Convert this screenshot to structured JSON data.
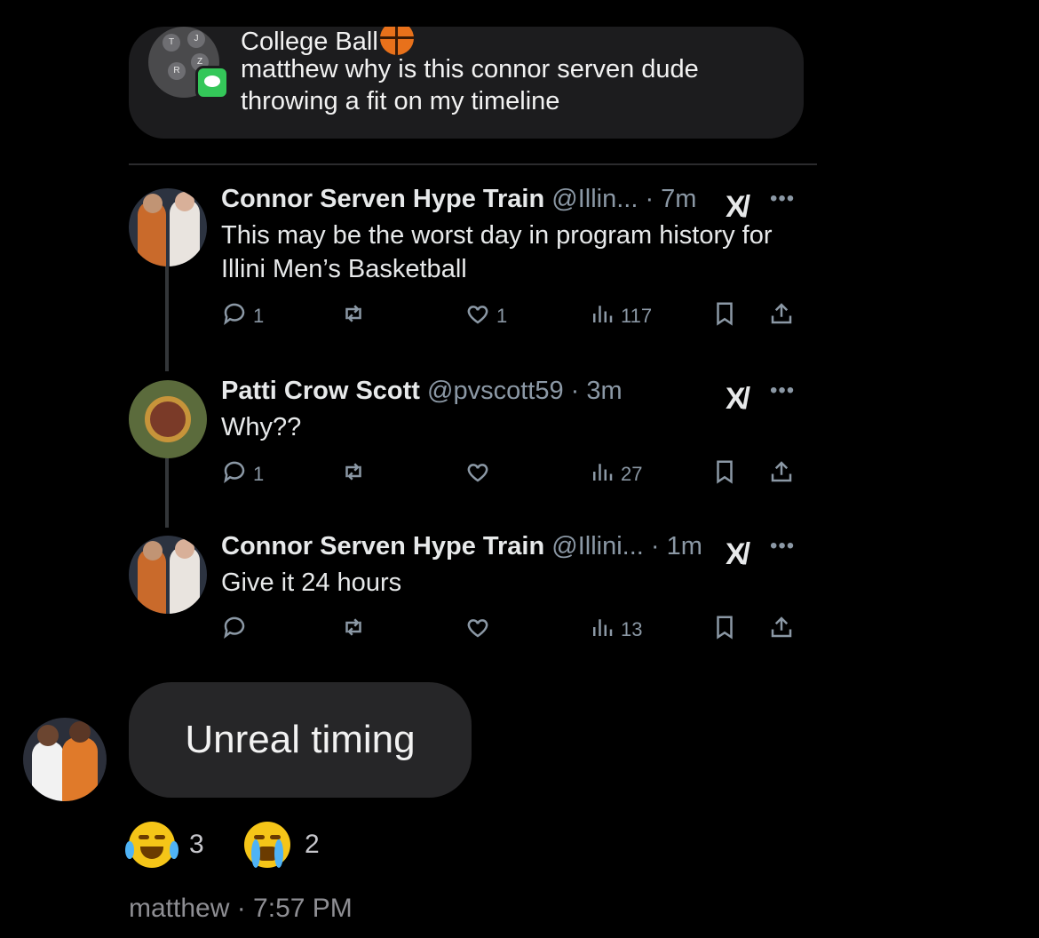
{
  "notification": {
    "group_initials": [
      "T",
      "J",
      "R",
      "Z"
    ],
    "title": "College Ball",
    "title_emoji": "basketball",
    "message": "matthew why is this connor serven dude throwing a fit on my timeline"
  },
  "tweets": [
    {
      "name": "Connor Serven Hype Train",
      "handle": "@Illin...",
      "time": "· 7m",
      "text": "This may be the worst day in program history for Illini Men’s Basketball",
      "replies": "1",
      "retweets": "",
      "likes": "1",
      "views": "117"
    },
    {
      "name": "Patti Crow Scott",
      "handle": "@pvscott59",
      "time": "· 3m",
      "text": "Why??",
      "replies": "1",
      "retweets": "",
      "likes": "",
      "views": "27"
    },
    {
      "name": "Connor Serven Hype Train",
      "handle": "@Illini...",
      "time": "· 1m",
      "text": "Give it 24 hours",
      "replies": "",
      "retweets": "",
      "likes": "",
      "views": "13"
    }
  ],
  "icons": {
    "grok": "grok-icon",
    "more": "more-icon",
    "reply": "reply-icon",
    "retweet": "retweet-icon",
    "like": "like-icon",
    "views": "views-icon",
    "bookmark": "bookmark-icon",
    "share": "share-icon"
  },
  "message": {
    "text": "Unreal timing",
    "reactions": [
      {
        "emoji": "face-with-tears-of-joy",
        "count": "3"
      },
      {
        "emoji": "loudly-crying-face",
        "count": "2"
      }
    ],
    "sender": "matthew",
    "time": "· 7:57 PM"
  },
  "colors": {
    "background": "#000000",
    "bubble": "#262628",
    "banner": "#1c1c1e",
    "muted": "#8b98a5"
  }
}
